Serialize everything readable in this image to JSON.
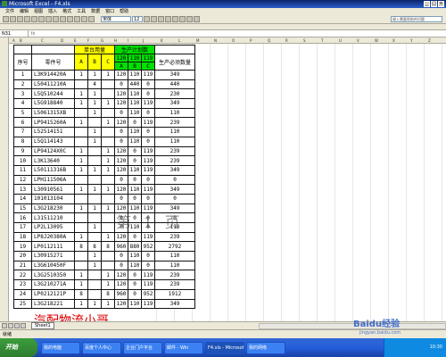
{
  "window": {
    "title": "Microsoft Excel - F4.xls"
  },
  "menu": [
    "文件",
    "编辑",
    "视图",
    "插入",
    "格式",
    "工具",
    "数据",
    "窗口",
    "帮助"
  ],
  "toolbar": {
    "font": "宋体",
    "size": "12",
    "help_placeholder": "键入需要帮助的问题"
  },
  "formula_bar": {
    "name_box": "N31",
    "fx": "fx",
    "content": ""
  },
  "column_letters": [
    "A",
    "B",
    "C",
    "D",
    "E",
    "F",
    "G",
    "H",
    "I",
    "J",
    "K",
    "L",
    "M",
    "N",
    "O",
    "P",
    "Q",
    "R",
    "S",
    "T",
    "U",
    "V",
    "W",
    "X",
    "Y",
    "Z"
  ],
  "sheet": {
    "group_header_unit": "单台用量",
    "group_header_plan": "生产计划数",
    "col_seq": "序号",
    "col_part": "零件号",
    "col_need": "生产必须数量",
    "unit_cols": [
      "A",
      "B",
      "C"
    ],
    "plan_vals": [
      "120",
      "110",
      "119"
    ],
    "plan_cols": [
      "A",
      "B",
      "C"
    ],
    "rows": [
      [
        "1",
        "L3K914420A",
        "1",
        "1",
        "1",
        "120",
        "110",
        "119",
        "349"
      ],
      [
        "2",
        "L50411210A",
        "",
        "4",
        "",
        "0",
        "440",
        "0",
        "440"
      ],
      [
        "3",
        "L5Q510244",
        "1",
        "1",
        "",
        "120",
        "110",
        "0",
        "230"
      ],
      [
        "4",
        "L5G918840",
        "1",
        "1",
        "1",
        "120",
        "110",
        "119",
        "349"
      ],
      [
        "5",
        "L5061315XB",
        "",
        "1",
        "",
        "0",
        "110",
        "0",
        "110"
      ],
      [
        "6",
        "LP9415260A",
        "1",
        "",
        "1",
        "120",
        "0",
        "119",
        "239"
      ],
      [
        "7",
        "L52514151",
        "",
        "1",
        "",
        "0",
        "110",
        "0",
        "110"
      ],
      [
        "8",
        "L5Q114143",
        "",
        "1",
        "",
        "0",
        "110",
        "0",
        "110"
      ],
      [
        "9",
        "LP94124X0C",
        "1",
        "",
        "1",
        "120",
        "0",
        "119",
        "239"
      ],
      [
        "10",
        "L3K13640",
        "1",
        "",
        "1",
        "120",
        "0",
        "119",
        "239"
      ],
      [
        "11",
        "L50111316B",
        "1",
        "1",
        "1",
        "120",
        "110",
        "119",
        "349"
      ],
      [
        "12",
        "LPH111506A",
        "",
        "",
        "",
        "0",
        "0",
        "0",
        "0"
      ],
      [
        "13",
        "L30910561",
        "1",
        "1",
        "1",
        "120",
        "110",
        "119",
        "349"
      ],
      [
        "14",
        "101013104",
        "",
        "",
        "",
        "0",
        "0",
        "0",
        "0"
      ],
      [
        "15",
        "L3G218230",
        "1",
        "1",
        "1",
        "120",
        "110",
        "119",
        "349"
      ],
      [
        "16",
        "L31511210",
        "",
        "",
        "",
        "0",
        "0",
        "0",
        "0"
      ],
      [
        "17",
        "LP2L13095",
        "",
        "1",
        "",
        "0",
        "110",
        "0",
        "110"
      ],
      [
        "18",
        "LP8J20380A",
        "1",
        "",
        "1",
        "120",
        "0",
        "119",
        "239"
      ],
      [
        "19",
        "LP0112111",
        "8",
        "8",
        "8",
        "960",
        "880",
        "952",
        "2792"
      ],
      [
        "20",
        "L30915271",
        "",
        "1",
        "",
        "0",
        "110",
        "0",
        "110"
      ],
      [
        "21",
        "L3G610450F",
        "",
        "1",
        "",
        "0",
        "110",
        "0",
        "110"
      ],
      [
        "22",
        "L3G2510350",
        "1",
        "",
        "1",
        "120",
        "0",
        "119",
        "239"
      ],
      [
        "23",
        "L3G210271A",
        "1",
        "",
        "1",
        "120",
        "0",
        "119",
        "239"
      ],
      [
        "24",
        "LP0212121P",
        "8",
        "",
        "8",
        "960",
        "0",
        "952",
        "1912"
      ],
      [
        "25",
        "L3G218221",
        "1",
        "1",
        "1",
        "120",
        "110",
        "119",
        "349"
      ]
    ]
  },
  "watermark_center": "第 1 页",
  "watermark_author": "汽配物流小哥",
  "sheet_tab": "Sheet1",
  "status": "就绪",
  "taskbar": {
    "start": "开始",
    "items": [
      "我的电脑",
      "百度个人中心",
      "企业门户平台",
      "邮件 - Win",
      "F4.xls - Microsoft",
      "我的网络"
    ],
    "clock": "10:30"
  },
  "brand": {
    "main": "Baidu经验",
    "sub": "jingyan.baidu.com"
  }
}
